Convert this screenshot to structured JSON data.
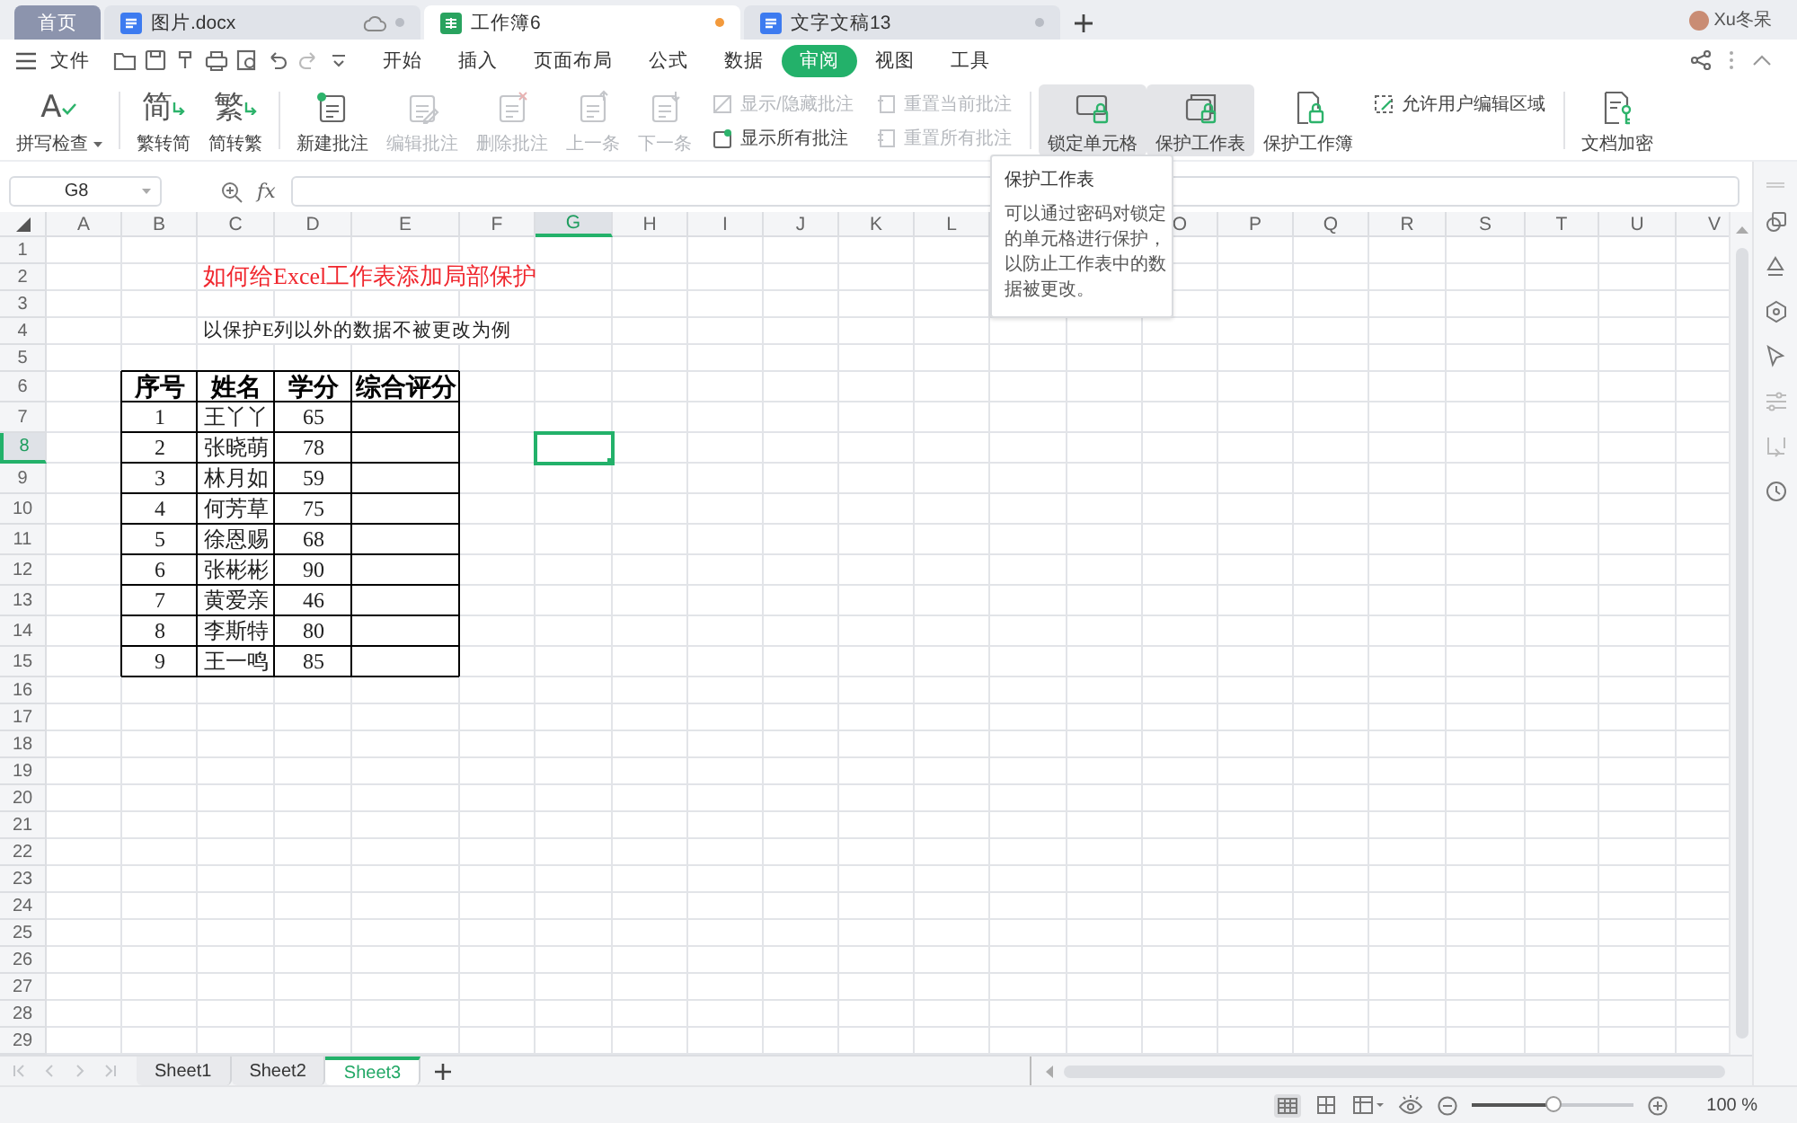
{
  "doc_tabs": [
    {
      "label": "首页",
      "kind": "home",
      "selected": false
    },
    {
      "label": "图片.docx",
      "kind": "writer",
      "selected": false,
      "modified": false,
      "cloud": true
    },
    {
      "label": "工作簿6",
      "kind": "sheet",
      "selected": true,
      "modified": true
    },
    {
      "label": "文字文稿13",
      "kind": "writer",
      "selected": false,
      "modified": false
    }
  ],
  "user": {
    "name": "Xu冬呆"
  },
  "menu": {
    "file": "文件",
    "tabs": [
      {
        "label": "开始",
        "selected": false
      },
      {
        "label": "插入",
        "selected": false
      },
      {
        "label": "页面布局",
        "selected": false
      },
      {
        "label": "公式",
        "selected": false
      },
      {
        "label": "数据",
        "selected": false
      },
      {
        "label": "审阅",
        "selected": true
      },
      {
        "label": "视图",
        "selected": false
      },
      {
        "label": "工具",
        "selected": false
      }
    ]
  },
  "ribbon": [
    {
      "kind": "large",
      "glyph": "A",
      "label": "拼写检查",
      "dropdown": true,
      "disabled": false,
      "highlighted": false
    },
    {
      "kind": "separator"
    },
    {
      "kind": "large",
      "glyph": "简",
      "label": "繁转简",
      "disabled": false,
      "highlighted": false
    },
    {
      "kind": "large",
      "glyph": "繁",
      "label": "简转繁",
      "disabled": false,
      "highlighted": false
    },
    {
      "kind": "separator"
    },
    {
      "kind": "large",
      "label": "新建批注",
      "disabled": false,
      "highlighted": false
    },
    {
      "kind": "large",
      "label": "编辑批注",
      "disabled": true,
      "highlighted": false
    },
    {
      "kind": "large",
      "label": "删除批注",
      "disabled": true,
      "highlighted": false
    },
    {
      "kind": "large",
      "label": "上一条",
      "disabled": true,
      "highlighted": false
    },
    {
      "kind": "large",
      "label": "下一条",
      "disabled": true,
      "highlighted": false
    },
    {
      "kind": "stack",
      "items": [
        {
          "label": "显示/隐藏批注",
          "disabled": true
        },
        {
          "label": "显示所有批注",
          "disabled": false
        }
      ]
    },
    {
      "kind": "stack",
      "items": [
        {
          "label": "重置当前批注",
          "disabled": true
        },
        {
          "label": "重置所有批注",
          "disabled": true
        }
      ]
    },
    {
      "kind": "separator"
    },
    {
      "kind": "large",
      "label": "锁定单元格",
      "disabled": false,
      "highlighted": true
    },
    {
      "kind": "large",
      "label": "保护工作表",
      "disabled": false,
      "highlighted": true
    },
    {
      "kind": "large",
      "label": "保护工作簿",
      "disabled": false,
      "highlighted": false
    },
    {
      "kind": "stack",
      "items": [
        {
          "label": "允许用户编辑区域",
          "disabled": false
        }
      ]
    },
    {
      "kind": "separator"
    },
    {
      "kind": "large",
      "label": "文档加密",
      "disabled": false,
      "highlighted": false
    }
  ],
  "formula_bar": {
    "name_box": "G8",
    "fx": "fx"
  },
  "sheet": {
    "columns": [
      {
        "label": "A",
        "selected": false
      },
      {
        "label": "B",
        "selected": false
      },
      {
        "label": "C",
        "selected": false
      },
      {
        "label": "D",
        "selected": false
      },
      {
        "label": "E",
        "selected": false
      },
      {
        "label": "F",
        "selected": false
      },
      {
        "label": "G",
        "selected": true
      },
      {
        "label": "H",
        "selected": false
      },
      {
        "label": "I",
        "selected": false
      },
      {
        "label": "J",
        "selected": false
      },
      {
        "label": "K",
        "selected": false
      },
      {
        "label": "L",
        "selected": false
      }
    ],
    "columns_right": [
      {
        "label": "O",
        "selected": false
      },
      {
        "label": "P",
        "selected": false
      },
      {
        "label": "Q",
        "selected": false
      },
      {
        "label": "R",
        "selected": false
      },
      {
        "label": "S",
        "selected": false
      },
      {
        "label": "T",
        "selected": false
      },
      {
        "label": "U",
        "selected": false
      },
      {
        "label": "V",
        "selected": false
      }
    ],
    "rows": [
      {
        "label": "1",
        "selected": false
      },
      {
        "label": "2",
        "selected": false
      },
      {
        "label": "3",
        "selected": false
      },
      {
        "label": "4",
        "selected": false
      },
      {
        "label": "5",
        "selected": false
      },
      {
        "label": "6",
        "selected": false
      },
      {
        "label": "7",
        "selected": false
      },
      {
        "label": "8",
        "selected": true
      },
      {
        "label": "9",
        "selected": false
      },
      {
        "label": "10",
        "selected": false
      },
      {
        "label": "11",
        "selected": false
      },
      {
        "label": "12",
        "selected": false
      },
      {
        "label": "13",
        "selected": false
      },
      {
        "label": "14",
        "selected": false
      },
      {
        "label": "15",
        "selected": false
      },
      {
        "label": "16",
        "selected": false
      },
      {
        "label": "17",
        "selected": false
      },
      {
        "label": "18",
        "selected": false
      },
      {
        "label": "19",
        "selected": false
      },
      {
        "label": "20",
        "selected": false
      },
      {
        "label": "21",
        "selected": false
      },
      {
        "label": "22",
        "selected": false
      },
      {
        "label": "23",
        "selected": false
      },
      {
        "label": "24",
        "selected": false
      },
      {
        "label": "25",
        "selected": false
      },
      {
        "label": "26",
        "selected": false
      },
      {
        "label": "27",
        "selected": false
      },
      {
        "label": "28",
        "selected": false
      },
      {
        "label": "29",
        "selected": false
      }
    ],
    "title": "如何给Excel工作表添加局部保护",
    "note": "以保护E列以外的数据不被更改为例",
    "table": {
      "columns": [
        "序号",
        "姓名",
        "学分",
        "综合评分"
      ],
      "rows": [
        [
          "1",
          "王丫丫",
          "65"
        ],
        [
          "2",
          "张晓萌",
          "78"
        ],
        [
          "3",
          "林月如",
          "59"
        ],
        [
          "4",
          "何芳草",
          "75"
        ],
        [
          "5",
          "徐恩赐",
          "68"
        ],
        [
          "6",
          "张彬彬",
          "90"
        ],
        [
          "7",
          "黄爱亲",
          "46"
        ],
        [
          "8",
          "李斯特",
          "80"
        ],
        [
          "9",
          "王一鸣",
          "85"
        ]
      ]
    }
  },
  "tooltip": {
    "title": "保护工作表",
    "text": "可以通过密码对锁定的单元格进行保护，以防止工作表中的数据被更改。"
  },
  "sheet_tabs": [
    {
      "label": "Sheet1",
      "selected": false
    },
    {
      "label": "Sheet2",
      "selected": false
    },
    {
      "label": "Sheet3",
      "selected": true
    }
  ],
  "status_bar": {
    "zoom": {
      "level": 0.5,
      "reading": "100 %"
    }
  }
}
